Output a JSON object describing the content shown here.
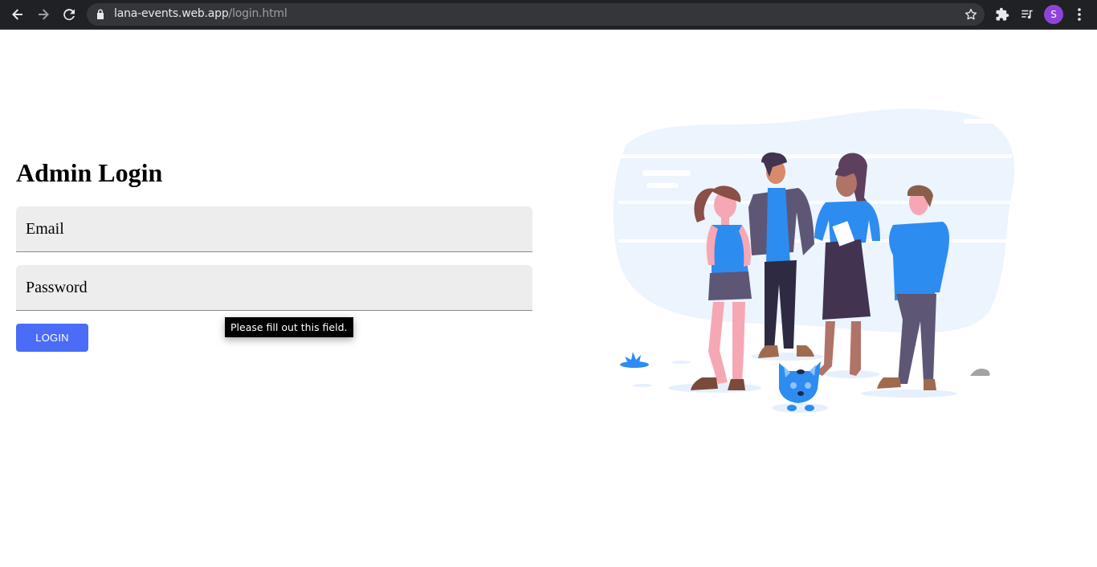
{
  "browser": {
    "url_host": "lana-events.web.app",
    "url_path": "/login.html",
    "profile_initial": "S",
    "icons": [
      "back-icon",
      "forward-icon",
      "reload-icon",
      "lock-icon",
      "bookmark-star-icon",
      "extensions-icon",
      "media-queue-icon",
      "menu-icon"
    ]
  },
  "page": {
    "title": "Admin Login",
    "email_placeholder": "Email",
    "password_placeholder": "Password",
    "login_label": "LOGIN",
    "validation_tooltip": "Please fill out this field."
  },
  "colors": {
    "button": "#4a6cf7",
    "field_bg": "#ededed",
    "accent_blue": "#2d8cf0"
  }
}
